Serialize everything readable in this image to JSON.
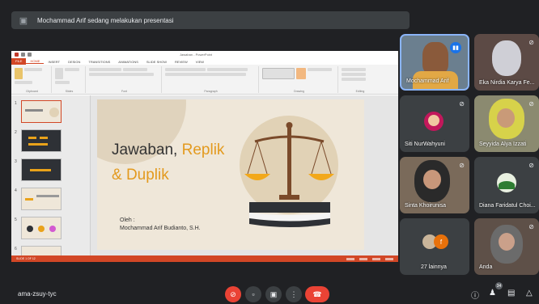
{
  "banner": {
    "icon": "presentation-icon",
    "text": "Mochammad Arif sedang melakukan presentasi"
  },
  "ppt": {
    "window_title": "Jawaban - PowerPoint",
    "tabs": [
      "FILE",
      "HOME",
      "INSERT",
      "DESIGN",
      "TRANSITIONS",
      "ANIMATIONS",
      "SLIDE SHOW",
      "REVIEW",
      "VIEW"
    ],
    "groups": [
      "Clipboard",
      "Slides",
      "Font",
      "Paragraph",
      "Drawing",
      "Editing"
    ],
    "thumb_numbers": [
      "1",
      "2",
      "3",
      "4",
      "5",
      "6"
    ],
    "status_left": "SLIDE 1 OF 12",
    "slide": {
      "title_part1": "Jawaban, ",
      "title_part2": "Replik",
      "title_line2": "& Duplik",
      "oleh": "Oleh :",
      "author": "Mochammad Arif Budianto, S.H."
    }
  },
  "participants": [
    {
      "name": "Mochammad Arif",
      "speaking": true
    },
    {
      "name": "Eka Nirdia Karya Fe...",
      "muted": true
    },
    {
      "name": "Siti NurWahyuni",
      "muted": true
    },
    {
      "name": "Seyyida Alya Izzati",
      "muted": true
    },
    {
      "name": "Sinta Khoirunisa",
      "muted": true
    },
    {
      "name": "Diana Faridatul Choi...",
      "muted": true
    },
    {
      "name": "27 lainnya",
      "avatar_letter": "f"
    },
    {
      "name": "Anda",
      "muted": true
    }
  ],
  "controls": {
    "meeting_code": "ama-zsuy-tyc",
    "people_count": "34"
  },
  "colors": {
    "background": "#202124",
    "tile": "#3c4043",
    "end_call": "#ea4335",
    "ppt_accent": "#d24726",
    "slide_orange": "#e39a1e",
    "speaking_blue": "#1a73e8"
  }
}
